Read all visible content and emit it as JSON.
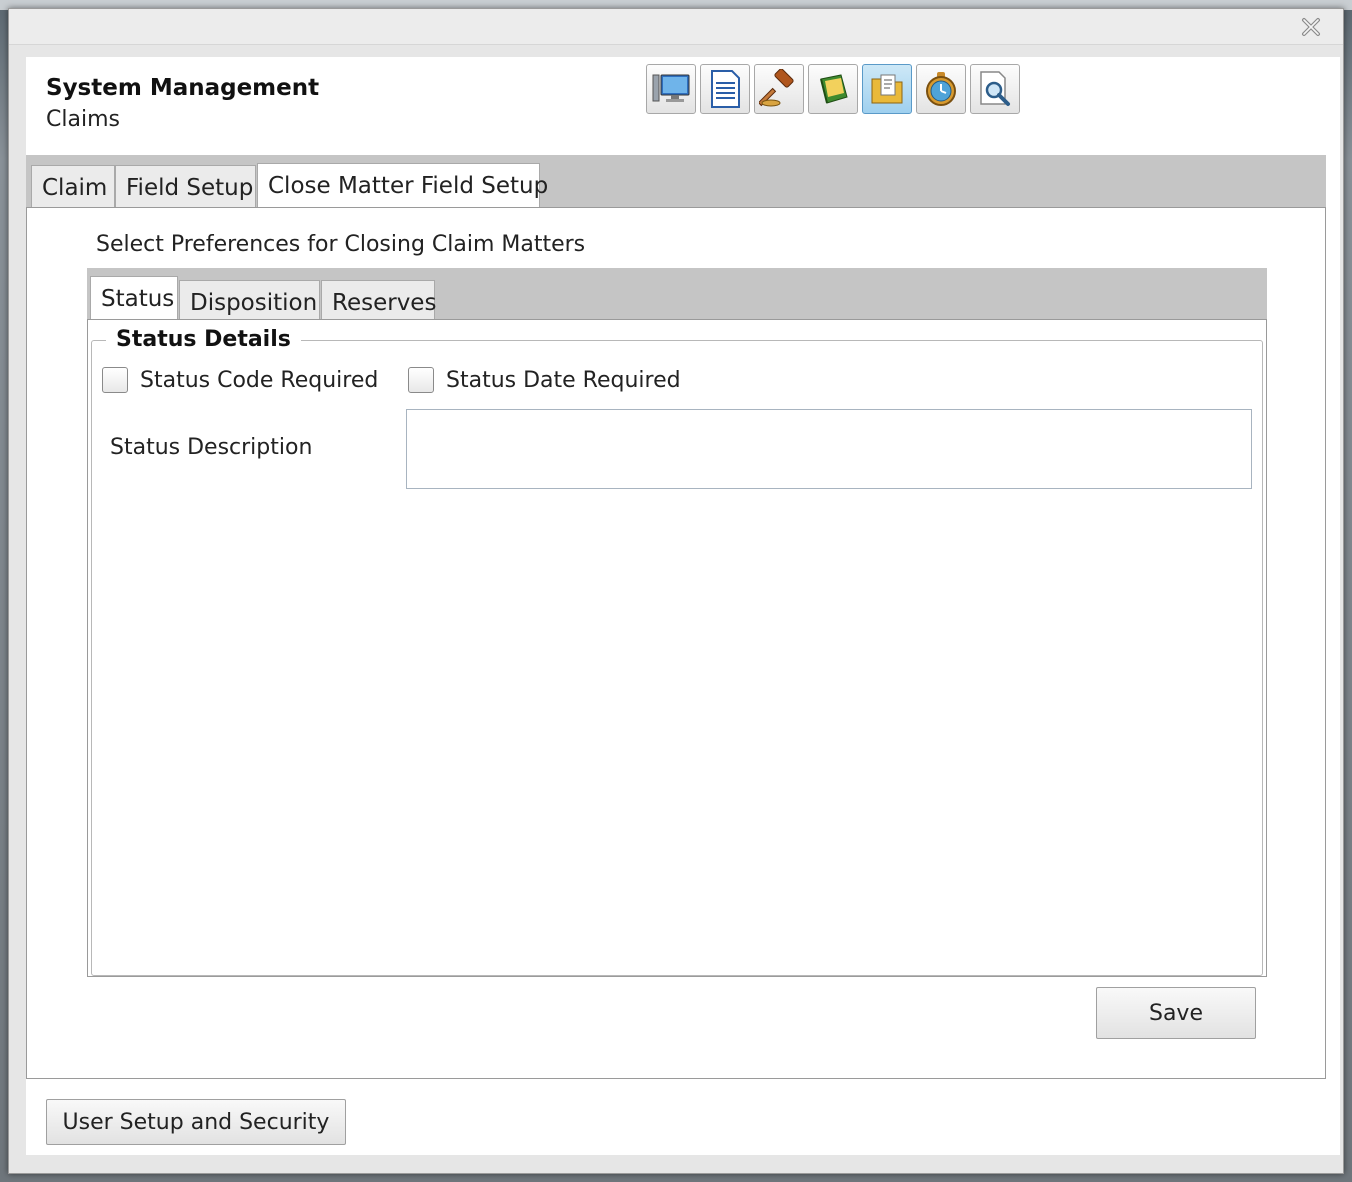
{
  "window": {
    "close_icon": "close-x-icon"
  },
  "header": {
    "title": "System Management",
    "subtitle": "Claims"
  },
  "toolbar": {
    "buttons": [
      {
        "icon": "computer-monitor-icon"
      },
      {
        "icon": "document-icon"
      },
      {
        "icon": "gavel-icon"
      },
      {
        "icon": "ledger-book-icon"
      },
      {
        "icon": "folder-notes-icon",
        "active": true
      },
      {
        "icon": "pocket-watch-icon"
      },
      {
        "icon": "magnifier-document-icon"
      }
    ]
  },
  "outer_tabs": [
    {
      "label": "Claim"
    },
    {
      "label": "Field Setup"
    },
    {
      "label": "Close Matter Field Setup",
      "selected": true
    }
  ],
  "main": {
    "preferences_label": "Select Preferences for Closing Claim Matters",
    "inner_tabs": [
      {
        "label": "Status",
        "selected": true
      },
      {
        "label": "Disposition"
      },
      {
        "label": "Reserves"
      }
    ],
    "group_title": "Status Details",
    "status_code_required": {
      "label": "Status Code Required",
      "checked": false
    },
    "status_date_required": {
      "label": "Status Date Required",
      "checked": false
    },
    "status_description": {
      "label": "Status Description",
      "value": ""
    },
    "save_label": "Save"
  },
  "footer": {
    "user_setup_label": "User Setup and Security"
  }
}
